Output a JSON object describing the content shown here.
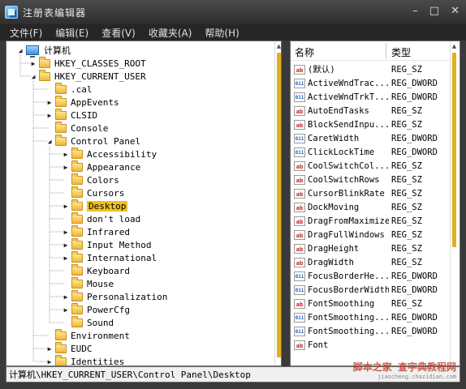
{
  "window": {
    "title": "注册表编辑器",
    "controls": [
      "–",
      "□",
      "✕"
    ]
  },
  "menu": [
    "文件(F)",
    "编辑(E)",
    "查看(V)",
    "收藏夹(A)",
    "帮助(H)"
  ],
  "tree": [
    {
      "label": "计算机",
      "level": 0,
      "state": "expanded",
      "icon": "computer-icon"
    },
    {
      "label": "HKEY_CLASSES_ROOT",
      "level": 1,
      "state": "collapsed"
    },
    {
      "label": "HKEY_CURRENT_USER",
      "level": 1,
      "state": "expanded"
    },
    {
      "label": ".cal",
      "level": 2,
      "state": "leaf"
    },
    {
      "label": "AppEvents",
      "level": 2,
      "state": "collapsed"
    },
    {
      "label": "CLSID",
      "level": 2,
      "state": "collapsed"
    },
    {
      "label": "Console",
      "level": 2,
      "state": "leaf"
    },
    {
      "label": "Control Panel",
      "level": 2,
      "state": "expanded"
    },
    {
      "label": "Accessibility",
      "level": 3,
      "state": "collapsed"
    },
    {
      "label": "Appearance",
      "level": 3,
      "state": "collapsed"
    },
    {
      "label": "Colors",
      "level": 3,
      "state": "leaf"
    },
    {
      "label": "Cursors",
      "level": 3,
      "state": "leaf"
    },
    {
      "label": "Desktop",
      "level": 3,
      "state": "collapsed",
      "selected": true
    },
    {
      "label": "don't load",
      "level": 3,
      "state": "leaf"
    },
    {
      "label": "Infrared",
      "level": 3,
      "state": "collapsed"
    },
    {
      "label": "Input Method",
      "level": 3,
      "state": "collapsed"
    },
    {
      "label": "International",
      "level": 3,
      "state": "collapsed"
    },
    {
      "label": "Keyboard",
      "level": 3,
      "state": "leaf"
    },
    {
      "label": "Mouse",
      "level": 3,
      "state": "leaf"
    },
    {
      "label": "Personalization",
      "level": 3,
      "state": "collapsed"
    },
    {
      "label": "PowerCfg",
      "level": 3,
      "state": "collapsed"
    },
    {
      "label": "Sound",
      "level": 3,
      "state": "leaf"
    },
    {
      "label": "Environment",
      "level": 2,
      "state": "leaf"
    },
    {
      "label": "EUDC",
      "level": 2,
      "state": "collapsed"
    },
    {
      "label": "Identities",
      "level": 2,
      "state": "collapsed"
    }
  ],
  "list": {
    "headers": {
      "name": "名称",
      "type": "类型"
    },
    "rows": [
      {
        "name": "(默认)",
        "type": "REG_SZ",
        "icon": "sz"
      },
      {
        "name": "ActiveWndTrac...",
        "type": "REG_DWORD",
        "icon": "dw"
      },
      {
        "name": "ActiveWndTrkT...",
        "type": "REG_DWORD",
        "icon": "dw"
      },
      {
        "name": "AutoEndTasks",
        "type": "REG_SZ",
        "icon": "sz"
      },
      {
        "name": "BlockSendInpu...",
        "type": "REG_SZ",
        "icon": "sz"
      },
      {
        "name": "CaretWidth",
        "type": "REG_DWORD",
        "icon": "dw"
      },
      {
        "name": "ClickLockTime",
        "type": "REG_DWORD",
        "icon": "dw"
      },
      {
        "name": "CoolSwitchCol...",
        "type": "REG_SZ",
        "icon": "sz"
      },
      {
        "name": "CoolSwitchRows",
        "type": "REG_SZ",
        "icon": "sz"
      },
      {
        "name": "CursorBlinkRate",
        "type": "REG_SZ",
        "icon": "sz"
      },
      {
        "name": "DockMoving",
        "type": "REG_SZ",
        "icon": "sz"
      },
      {
        "name": "DragFromMaximize",
        "type": "REG_SZ",
        "icon": "sz"
      },
      {
        "name": "DragFullWindows",
        "type": "REG_SZ",
        "icon": "sz"
      },
      {
        "name": "DragHeight",
        "type": "REG_SZ",
        "icon": "sz"
      },
      {
        "name": "DragWidth",
        "type": "REG_SZ",
        "icon": "sz"
      },
      {
        "name": "FocusBorderHe...",
        "type": "REG_DWORD",
        "icon": "dw"
      },
      {
        "name": "FocusBorderWidth",
        "type": "REG_DWORD",
        "icon": "dw"
      },
      {
        "name": "FontSmoothing",
        "type": "REG_SZ",
        "icon": "sz"
      },
      {
        "name": "FontSmoothing...",
        "type": "REG_DWORD",
        "icon": "dw"
      },
      {
        "name": "FontSmoothing...",
        "type": "REG_DWORD",
        "icon": "dw"
      },
      {
        "name": "Font",
        "type": "",
        "icon": "sz"
      }
    ]
  },
  "statusbar": {
    "path": "计算机\\HKEY_CURRENT_USER\\Control Panel\\Desktop"
  },
  "watermark": {
    "main": "脚本之家 查字典教程网",
    "sub": "jiaocheng.chazidian.com"
  },
  "colors": {
    "accent": "#f0c020",
    "scroll_thumb": "#e0b020",
    "chrome": "#2e2e2e"
  }
}
